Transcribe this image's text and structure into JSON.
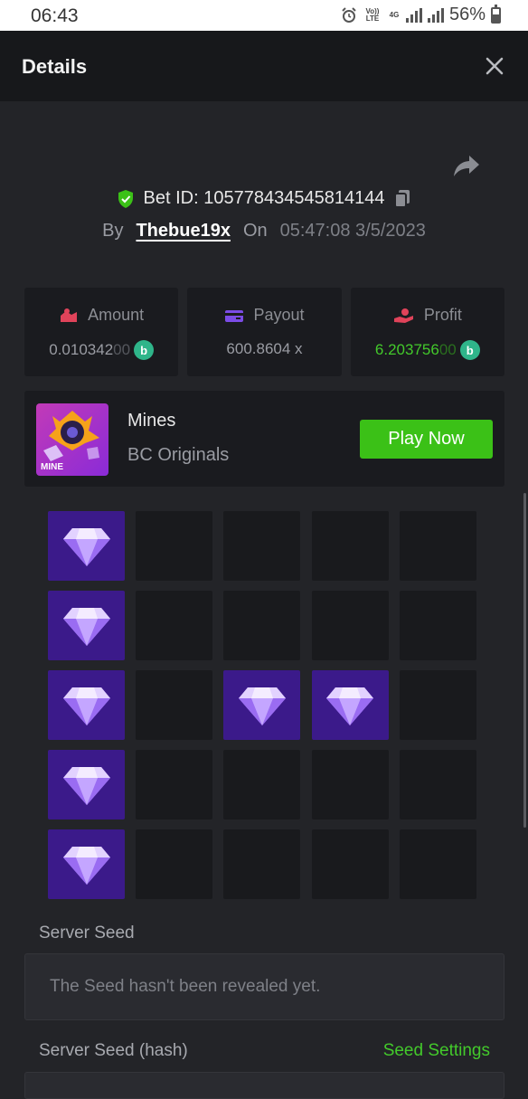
{
  "status_bar": {
    "time": "06:43",
    "volte": "Vo)) LTE",
    "network": "4G",
    "battery": "56%"
  },
  "header": {
    "title": "Details"
  },
  "bet": {
    "id_label": "Bet ID: 105778434545814144",
    "by_label": "By",
    "username": "Thebue19x",
    "on_label": "On",
    "datetime": "05:47:08 3/5/2023"
  },
  "stats": {
    "amount": {
      "label": "Amount",
      "value_main": "0.010342",
      "value_tail": "00"
    },
    "payout": {
      "label": "Payout",
      "value": "600.8604 x"
    },
    "profit": {
      "label": "Profit",
      "value_main": "6.203756",
      "value_tail": "00"
    },
    "coin_symbol": "b"
  },
  "game": {
    "thumb_label": "MINE",
    "name": "Mines",
    "provider": "BC Originals",
    "play_label": "Play Now"
  },
  "mines_grid": {
    "rows": 5,
    "cols": 5,
    "cells": [
      [
        "gem",
        "empty",
        "empty",
        "empty",
        "empty"
      ],
      [
        "gem",
        "empty",
        "empty",
        "empty",
        "empty"
      ],
      [
        "gem",
        "empty",
        "gem",
        "gem",
        "empty"
      ],
      [
        "gem",
        "empty",
        "empty",
        "empty",
        "empty"
      ],
      [
        "gem",
        "empty",
        "empty",
        "empty",
        "empty"
      ]
    ]
  },
  "server_seed": {
    "label": "Server Seed",
    "value": "The Seed hasn't been revealed yet.",
    "hash_label": "Server Seed (hash)",
    "settings_link": "Seed Settings"
  },
  "colors": {
    "accent_green": "#3bc117",
    "gem_tile": "#3b1a8a",
    "background": "#232428"
  }
}
